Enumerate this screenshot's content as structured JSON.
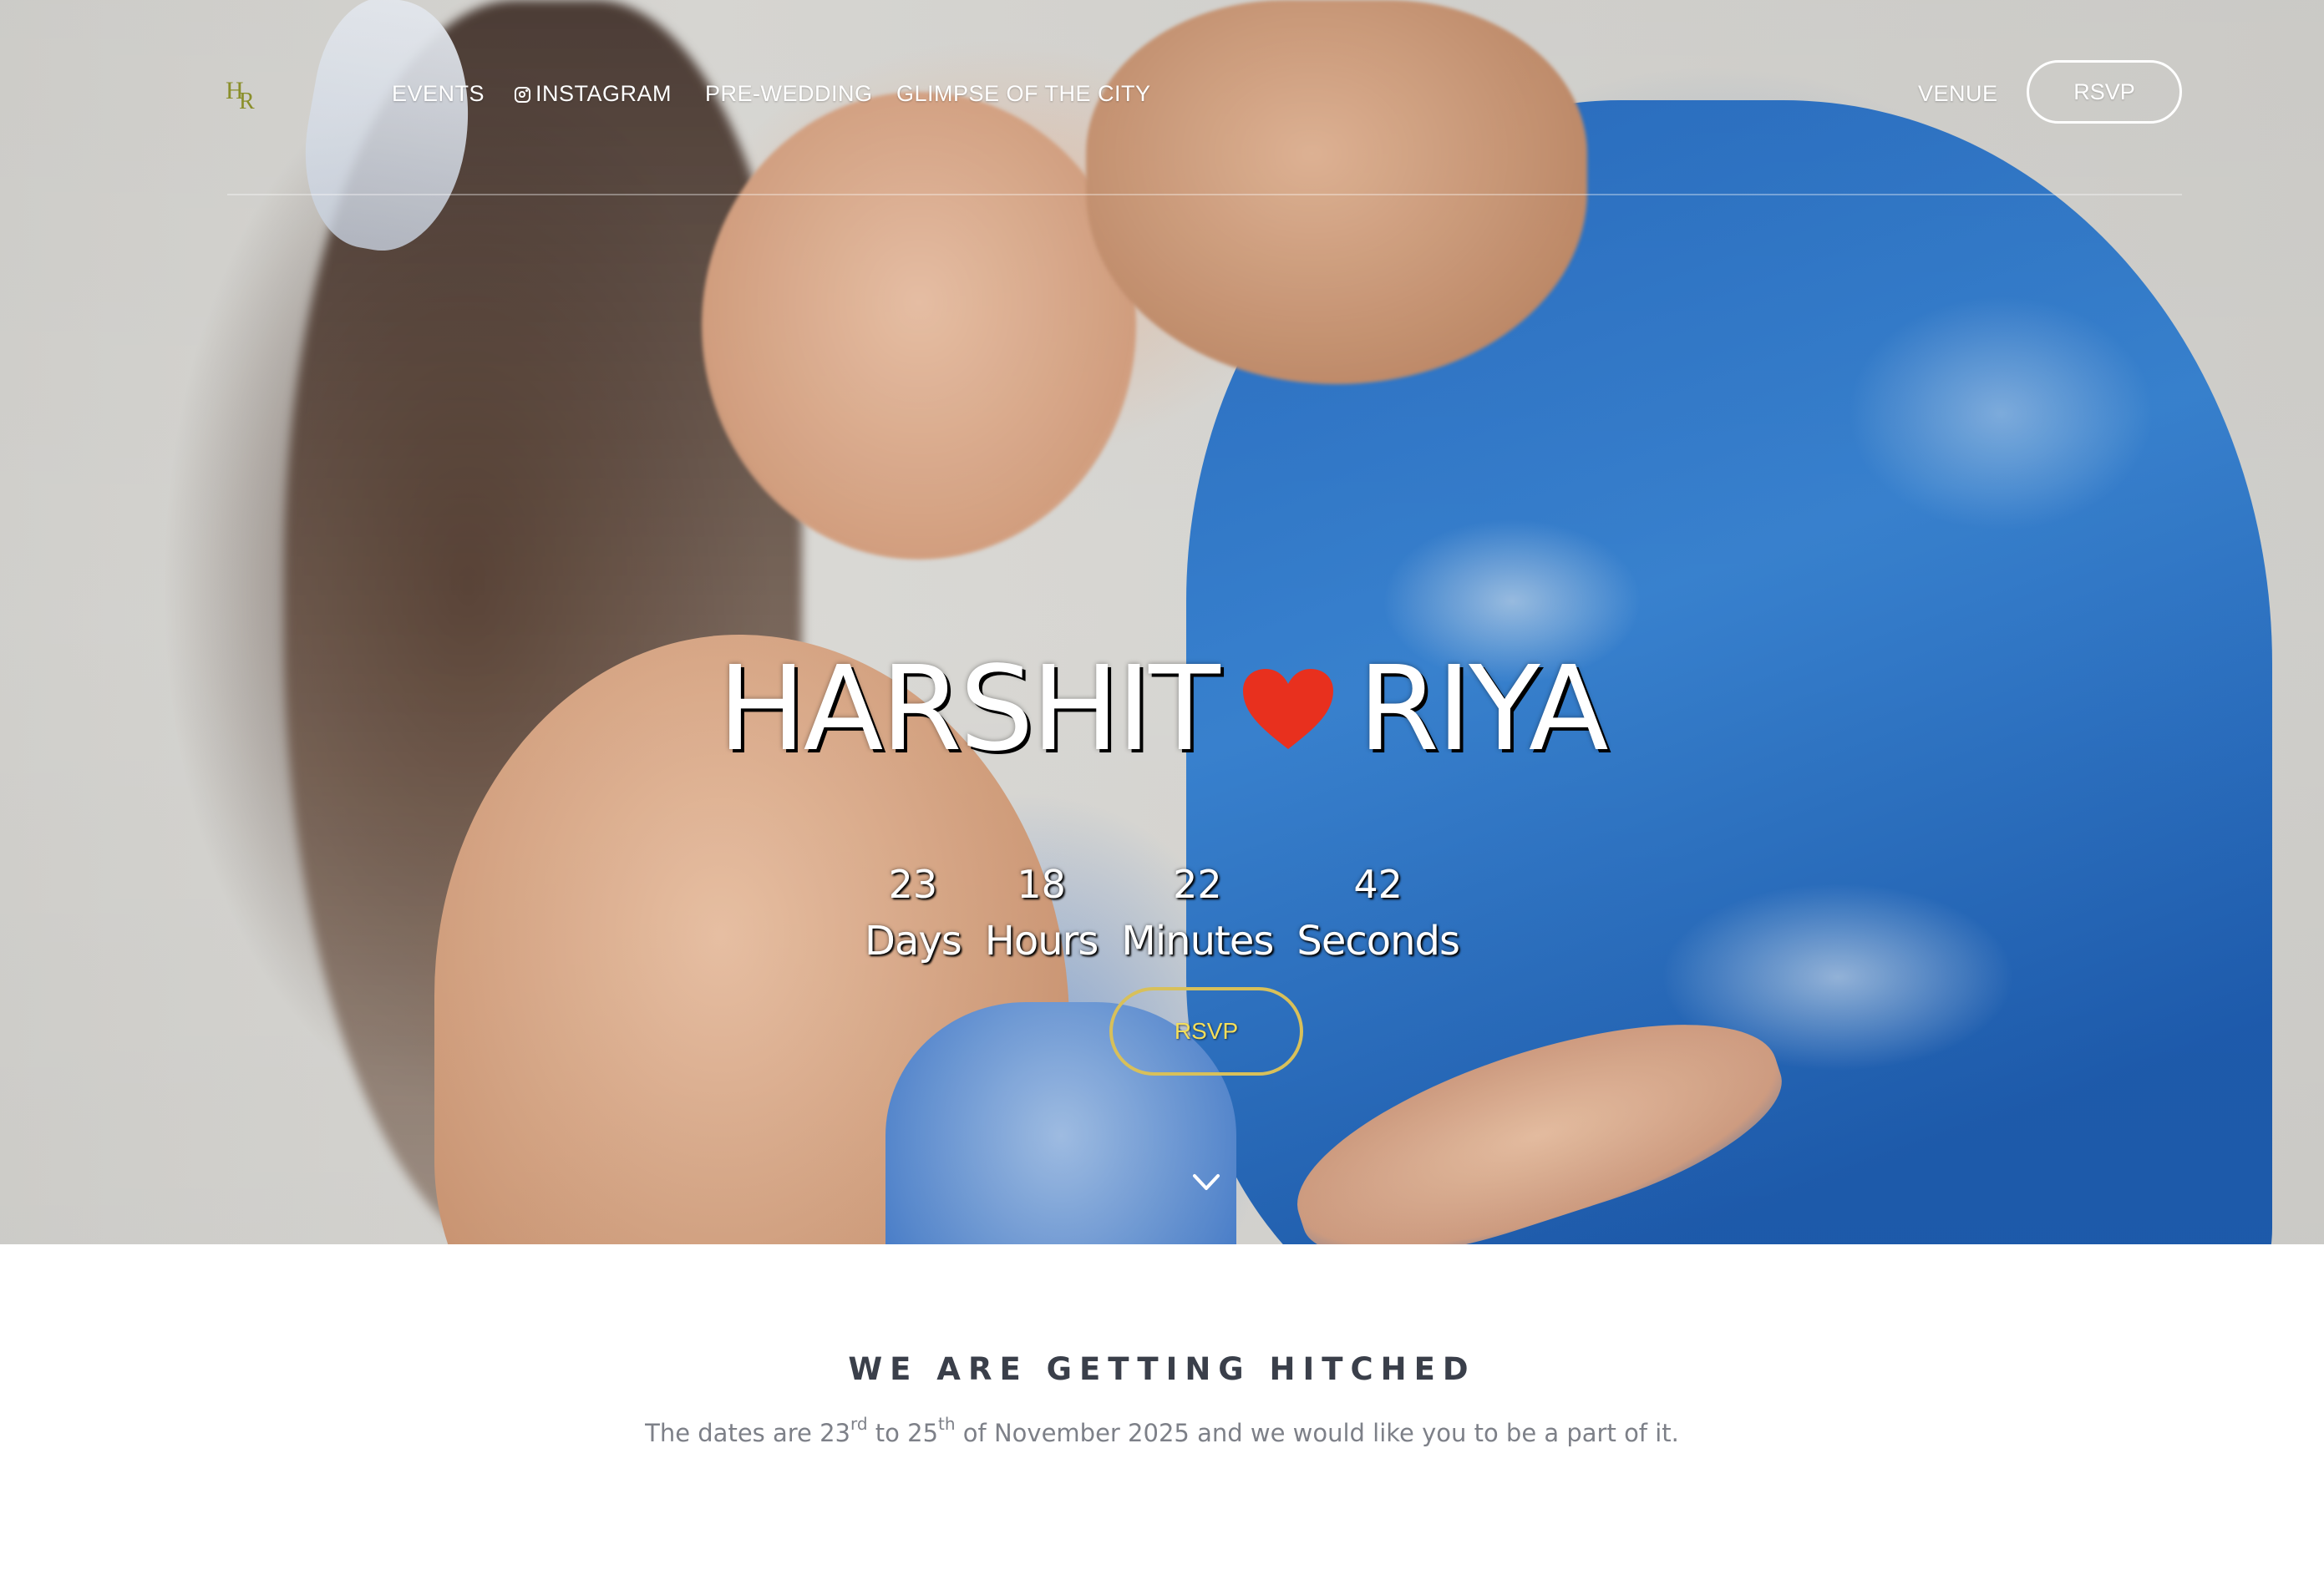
{
  "nav": {
    "logo_text_1": "H",
    "logo_text_2": "R",
    "links": [
      {
        "label": "EVENTS"
      },
      {
        "label": "INSTAGRAM",
        "icon": "instagram-icon"
      },
      {
        "label": "PRE-WEDDING"
      },
      {
        "label": "GLIMPSE OF THE CITY"
      }
    ],
    "venue_label": "VENUE",
    "rsvp_label": "RSVP"
  },
  "hero": {
    "name_left": "HARSHIT",
    "name_right": "RIYA",
    "heart_icon": "heart-icon",
    "heart_color": "#e8301e",
    "countdown": [
      {
        "value": "23",
        "label": "Days"
      },
      {
        "value": "18",
        "label": "Hours"
      },
      {
        "value": "22",
        "label": "Minutes"
      },
      {
        "value": "42",
        "label": "Seconds"
      }
    ],
    "rsvp_label": "RSVP",
    "rsvp_color": "#d8c05a",
    "scroll_icon": "chevron-down-icon"
  },
  "intro": {
    "title": "WE ARE GETTING HITCHED",
    "text_1": "The dates are 23",
    "sup_1": "rd",
    "text_2": " to 25",
    "sup_2": "th",
    "text_3": " of November 2025 and we would like you to be a part of it."
  }
}
